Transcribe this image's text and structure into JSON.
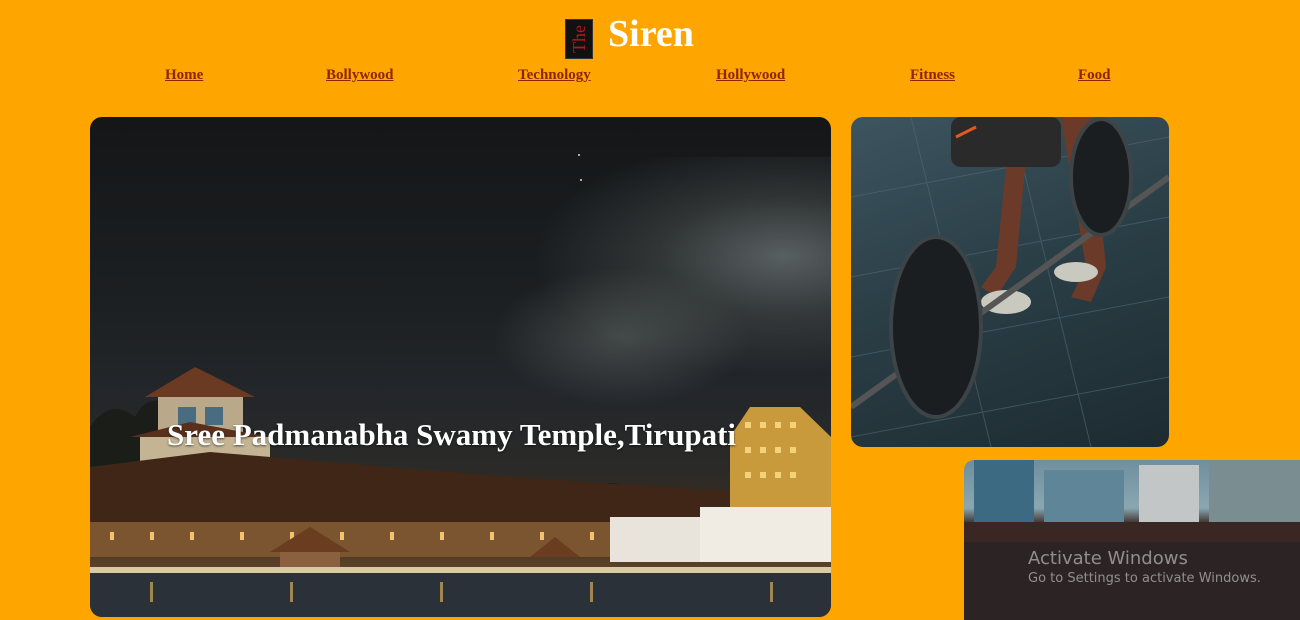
{
  "header": {
    "logo_text": "The",
    "title": "Siren"
  },
  "nav": {
    "items": [
      {
        "label": "Home"
      },
      {
        "label": "Bollywood"
      },
      {
        "label": "Technology"
      },
      {
        "label": "Hollywood"
      },
      {
        "label": "Fitness"
      },
      {
        "label": "Food"
      }
    ]
  },
  "featured": {
    "caption": "Sree Padmanabha Swamy Temple,Tirupati"
  },
  "windows_watermark": {
    "line1": "Activate Windows",
    "line2": "Go to Settings to activate Windows."
  },
  "colors": {
    "background": "#ffa500",
    "nav_link": "#8b2500",
    "title": "#ffffff",
    "logo_text": "#c0121a"
  }
}
